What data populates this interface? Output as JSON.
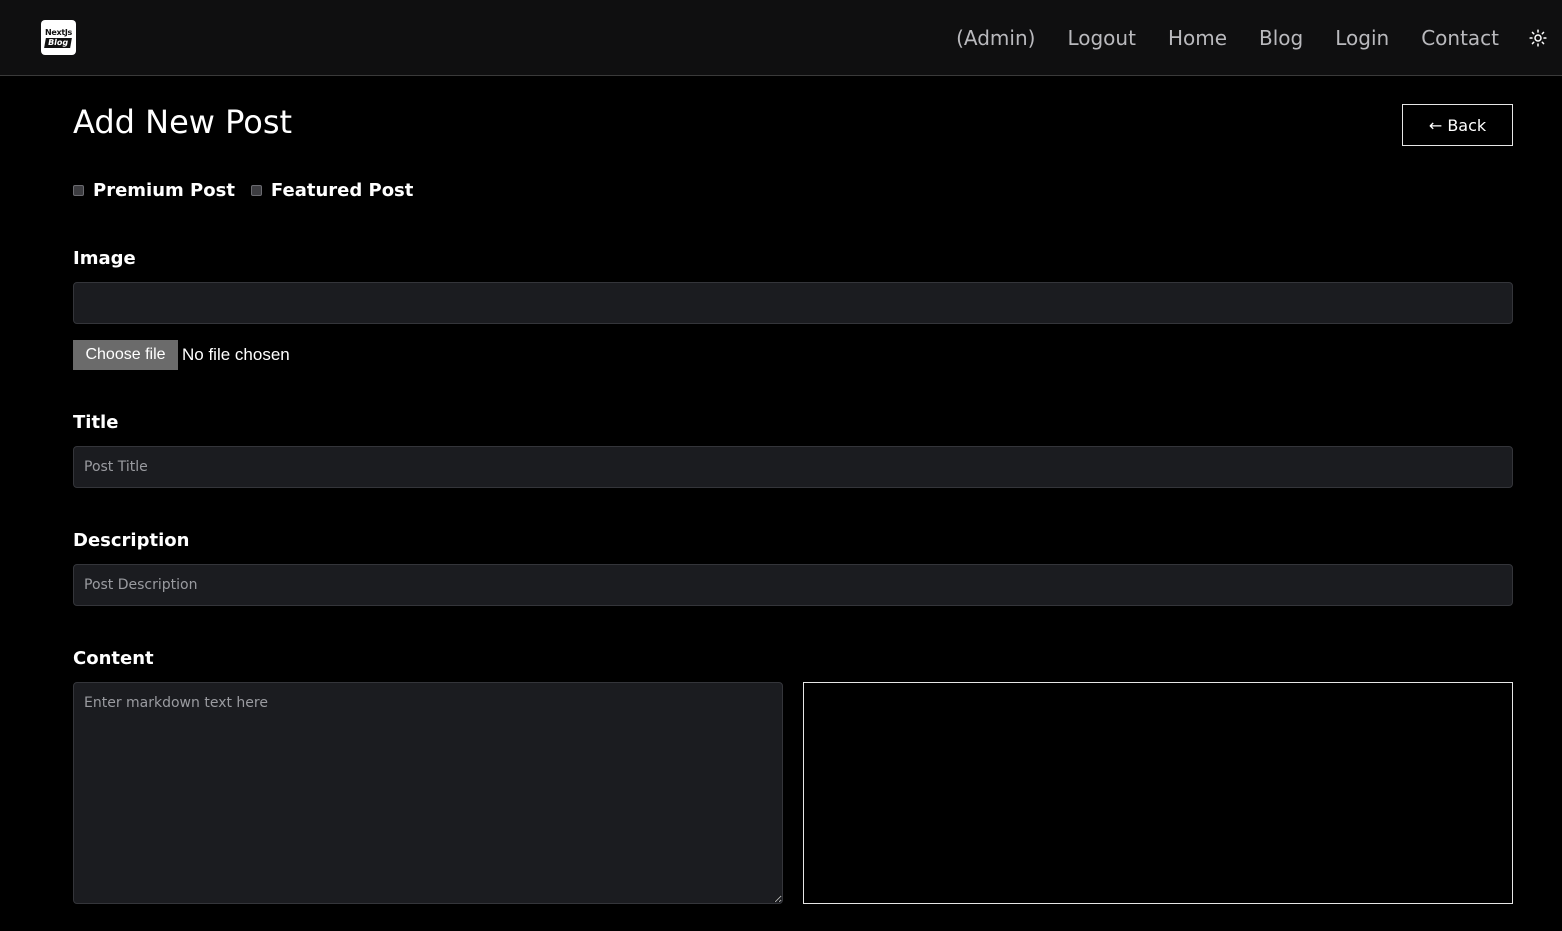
{
  "logo": {
    "line1": "NextJs",
    "line2": "Blog"
  },
  "nav": {
    "items": [
      {
        "label": "(Admin)"
      },
      {
        "label": "Logout"
      },
      {
        "label": "Home"
      },
      {
        "label": "Blog"
      },
      {
        "label": "Login"
      },
      {
        "label": "Contact"
      }
    ],
    "theme_icon": "sun-icon"
  },
  "page": {
    "title": "Add New Post",
    "back_label": "← Back"
  },
  "options": {
    "premium_label": "Premium Post",
    "premium_checked": false,
    "featured_label": "Featured Post",
    "featured_checked": false
  },
  "image": {
    "label": "Image",
    "value": "",
    "choose_file_label": "Choose file",
    "file_status": "No file chosen"
  },
  "title_field": {
    "label": "Title",
    "placeholder": "Post Title",
    "value": ""
  },
  "description_field": {
    "label": "Description",
    "placeholder": "Post Description",
    "value": ""
  },
  "content_field": {
    "label": "Content",
    "placeholder": "Enter markdown text here",
    "value": "",
    "preview": ""
  },
  "colors": {
    "background": "#000000",
    "navbar": "#0f0f10",
    "input_bg": "#1b1c20",
    "nav_text": "#b9b9bd"
  }
}
